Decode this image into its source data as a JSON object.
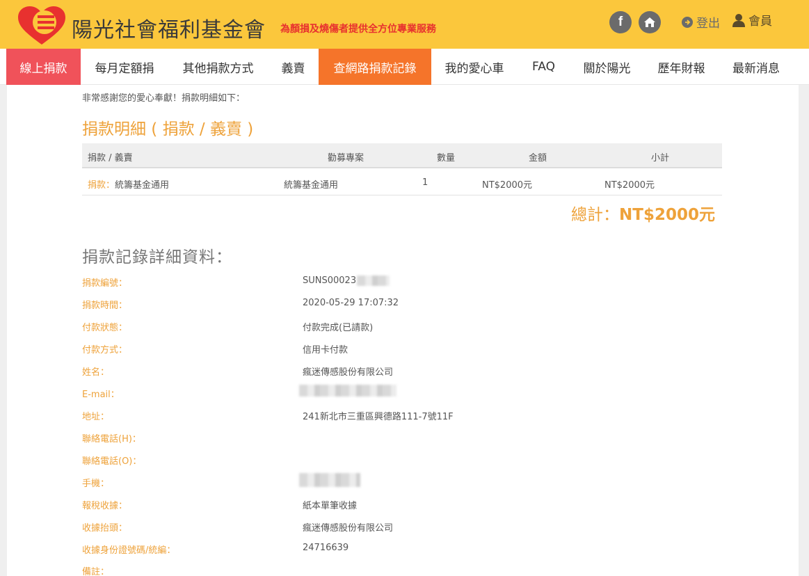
{
  "header": {
    "logo_text": "陽光社會福利基金會",
    "slogan": "為顏損及燒傷者提供全方位專業服務",
    "facebook_glyph": "f",
    "logout_label": "登出",
    "member_label": "會員",
    "colors": {
      "bar": "#fbc73c",
      "slogan": "#e8312f",
      "icon_bg": "#6b6b6b"
    }
  },
  "nav": {
    "items": [
      {
        "label": "線上捐款",
        "style": "red"
      },
      {
        "label": "每月定額捐",
        "style": "normal"
      },
      {
        "label": "其他捐款方式",
        "style": "normal"
      },
      {
        "label": "義賣",
        "style": "normal"
      },
      {
        "label": "查網路捐款記錄",
        "style": "orange"
      },
      {
        "label": "我的愛心車",
        "style": "normal"
      },
      {
        "label": "FAQ",
        "style": "normal"
      },
      {
        "label": "關於陽光",
        "style": "normal"
      },
      {
        "label": "歷年財報",
        "style": "normal"
      },
      {
        "label": "最新消息",
        "style": "normal"
      }
    ],
    "colors": {
      "active_red": "#f0525a",
      "active_orange": "#f5742a"
    }
  },
  "content": {
    "thanks": "非常感謝您的愛心奉獻！捐款明細如下：",
    "section_title": "捐款明細 ( 捐款 / 義賣 )",
    "table": {
      "headers": [
        "捐款 / 義賣",
        "勸募專案",
        "數量",
        "金額",
        "小計"
      ],
      "rows": [
        {
          "type_prefix": "捐款：",
          "type_name": "統籌基金通用",
          "project": "統籌基金通用",
          "qty": "1",
          "amount": "NT$2000元",
          "subtotal": "NT$2000元"
        }
      ]
    },
    "total_label": "總計：",
    "total_value": "NT$2000元",
    "detail_title": "捐款記錄詳細資料：",
    "details": [
      {
        "label": "捐款編號：",
        "value": "SUNS00023",
        "redacted": true
      },
      {
        "label": "捐款時間：",
        "value": "2020-05-29 17:07:32"
      },
      {
        "label": "付款狀態：",
        "value": "付款完成(已請款)"
      },
      {
        "label": "付款方式：",
        "value": "信用卡付款"
      },
      {
        "label": "姓名：",
        "value": "瘋迷傳感股份有限公司"
      },
      {
        "label": "E-mail：",
        "value": "",
        "redacted": true
      },
      {
        "label": "地址：",
        "value": "241新北市三重區興德路111-7號11F"
      },
      {
        "label": "聯絡電話(H)：",
        "value": ""
      },
      {
        "label": "聯絡電話(O)：",
        "value": ""
      },
      {
        "label": "手機：",
        "value": "",
        "redacted": true
      },
      {
        "label": "報稅收據：",
        "value": "紙本單筆收據"
      },
      {
        "label": "收據抬頭：",
        "value": "瘋迷傳感股份有限公司"
      },
      {
        "label": "收據身份證號碼/統編：",
        "value": "24716639"
      },
      {
        "label": "備註：",
        "value": ""
      }
    ],
    "accent_color": "#eea23a"
  }
}
